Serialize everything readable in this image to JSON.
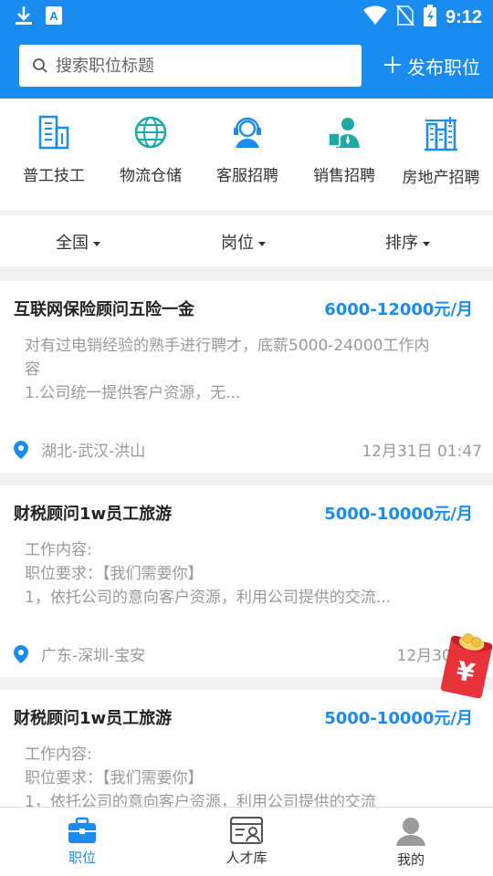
{
  "status_bar": {
    "time": "9:12",
    "icons": [
      "download-icon",
      "a-app-icon",
      "wifi-icon",
      "no-sim-icon",
      "battery-icon"
    ]
  },
  "header": {
    "search_placeholder": "搜索职位标题",
    "publish_label": "发布职位"
  },
  "categories": [
    {
      "label": "普工技工",
      "icon": "factory-building-icon"
    },
    {
      "label": "物流仓储",
      "icon": "globe-icon"
    },
    {
      "label": "客服招聘",
      "icon": "headset-agent-icon"
    },
    {
      "label": "销售招聘",
      "icon": "salesperson-icon"
    },
    {
      "label": "房地产招聘",
      "icon": "construction-crane-icon"
    }
  ],
  "filters": [
    {
      "label": "全国"
    },
    {
      "label": "岗位"
    },
    {
      "label": "排序"
    }
  ],
  "jobs": [
    {
      "title": "互联网保险顾问五险一金",
      "salary": "6000-12000元/月",
      "desc_line1": "对有过电销经验的熟手进行聘才，底薪5000-24000工作内",
      "desc_line2": "容",
      "desc_line3": "1.公司统一提供客户资源，无...",
      "location": "湖北-武汉-洪山",
      "date": "12月31日 01:47"
    },
    {
      "title": "财税顾问1w员工旅游",
      "salary": "5000-10000元/月",
      "desc_line1": "工作内容:",
      "desc_line2": "职位要求：【我们需要你】",
      "desc_line3": "1，依托公司的意向客户资源，利用公司提供的交流...",
      "location": "广东-深圳-宝安",
      "date": "12月30日 0"
    },
    {
      "title": "财税顾问1w员工旅游",
      "salary": "5000-10000元/月",
      "desc_line1": "工作内容:",
      "desc_line2": "职位要求：【我们需要你】",
      "desc_line3": "1，依托公司的意向客户资源，利用公司提供的交流",
      "location": "",
      "date": ""
    }
  ],
  "tabbar": [
    {
      "label": "职位",
      "icon": "briefcase-icon",
      "active": true
    },
    {
      "label": "人才库",
      "icon": "talent-card-icon",
      "active": false
    },
    {
      "label": "我的",
      "icon": "user-icon",
      "active": false
    }
  ],
  "colors": {
    "primary": "#1a8cf0",
    "teal": "#1fa9a4",
    "red_packet": "#e8333a"
  },
  "red_packet": {
    "symbol": "¥"
  }
}
